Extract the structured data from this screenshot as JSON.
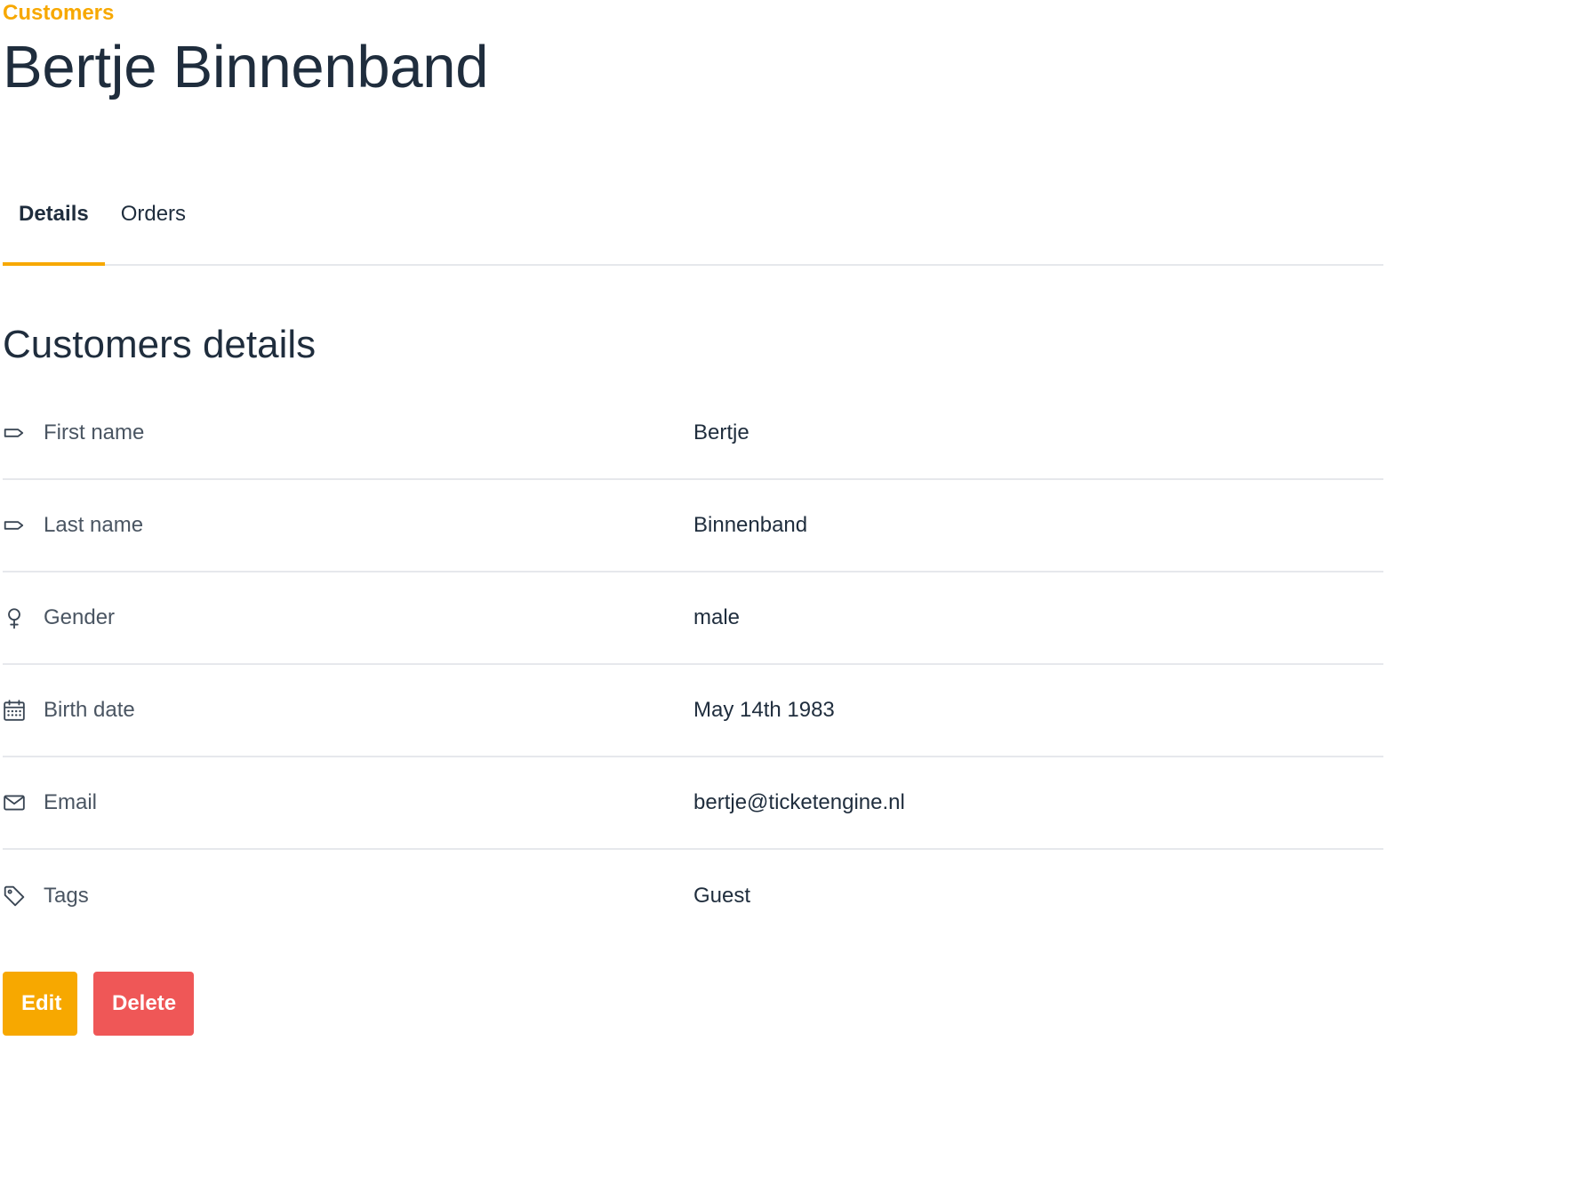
{
  "breadcrumb": {
    "label": "Customers"
  },
  "page": {
    "title": "Bertje Binnenband"
  },
  "tabs": [
    {
      "label": "Details",
      "active": true
    },
    {
      "label": "Orders",
      "active": false
    }
  ],
  "details": {
    "title": "Customers details",
    "rows": [
      {
        "icon": "label-icon",
        "label": "First name",
        "value": "Bertje"
      },
      {
        "icon": "label-icon",
        "label": "Last name",
        "value": "Binnenband"
      },
      {
        "icon": "gender-icon",
        "label": "Gender",
        "value": "male"
      },
      {
        "icon": "calendar-icon",
        "label": "Birth date",
        "value": "May 14th 1983"
      },
      {
        "icon": "mail-icon",
        "label": "Email",
        "value": "bertje@ticketengine.nl"
      },
      {
        "icon": "tag-icon",
        "label": "Tags",
        "value": "Guest"
      }
    ]
  },
  "actions": {
    "edit_label": "Edit",
    "delete_label": "Delete"
  },
  "colors": {
    "accent": "#f7a800",
    "danger": "#ef5757",
    "text": "#1f2d3d",
    "divider": "#e6e8ec"
  }
}
